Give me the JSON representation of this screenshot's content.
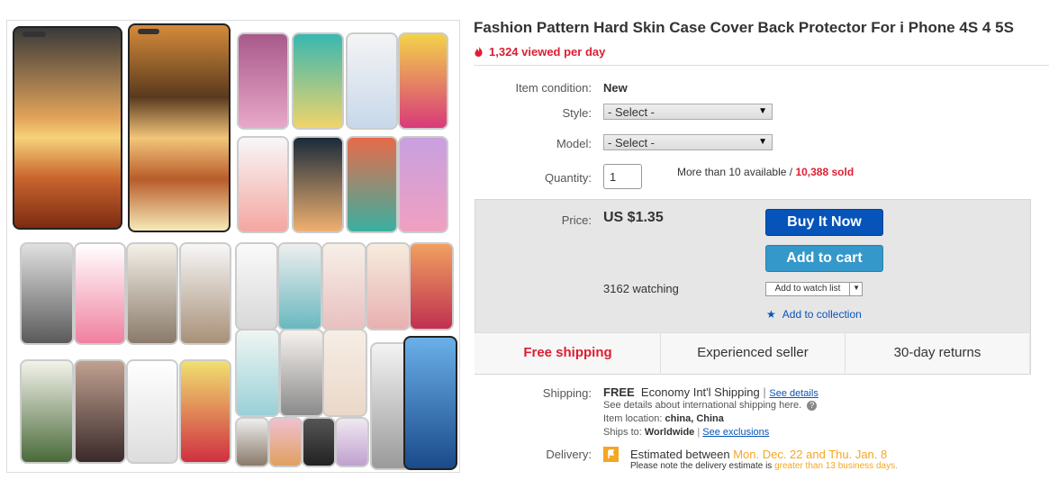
{
  "listing": {
    "title": "Fashion Pattern Hard Skin Case Cover Back Protector For i Phone 4S 4 5S",
    "views": "1,324 viewed per day"
  },
  "item": {
    "condition_label": "Item condition:",
    "condition_value": "New",
    "style_label": "Style:",
    "style_selected": "- Select -",
    "model_label": "Model:",
    "model_selected": "- Select -",
    "quantity_label": "Quantity:",
    "quantity_value": "1",
    "availability": "More than 10 available /",
    "sold": "10,388 sold"
  },
  "buybox": {
    "price_label": "Price:",
    "price": "US $1.35",
    "buy_now": "Buy It Now",
    "add_to_cart": "Add to cart",
    "watching": "3162 watching",
    "add_to_watch": "Add to watch list",
    "add_to_collection": "Add to collection",
    "badges": [
      "Free shipping",
      "Experienced seller",
      "30-day returns"
    ]
  },
  "shipping": {
    "label": "Shipping:",
    "free": "FREE",
    "service": "Economy Int'l Shipping",
    "see_details": "See details",
    "note": "See details about international shipping here.",
    "location_label": "Item location:",
    "location": "china, China",
    "ships_to_label": "Ships to:",
    "ships_to": "Worldwide",
    "exclusions": "See exclusions"
  },
  "delivery": {
    "label": "Delivery:",
    "estimated": "Estimated between",
    "dates": "Mon. Dec. 22 and Thu. Jan. 8",
    "note": "Please note the delivery estimate is",
    "note_highlight": "greater than 13 business days."
  },
  "colors": {
    "accent_blue": "#0654ba",
    "cart_blue": "#3498ca",
    "red": "#dd1e31",
    "orange": "#f5a623"
  }
}
